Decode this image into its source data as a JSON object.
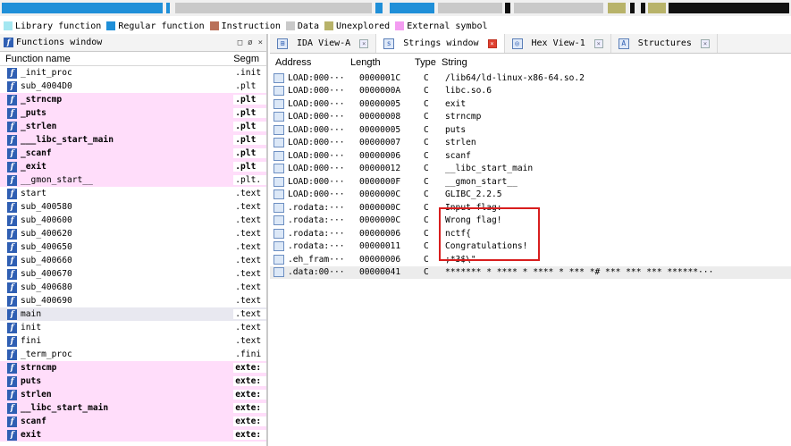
{
  "nav_band": {
    "colors": {
      "library": "#a4e7f1",
      "regular": "#1f8fd8",
      "instruction": "#b9715a",
      "data": "#c9c9c9",
      "unexplored": "#b8b36a",
      "external": "#f39cf1",
      "dark": "#111111"
    }
  },
  "legend": [
    {
      "label": "Library function",
      "color": "#a4e7f1"
    },
    {
      "label": "Regular function",
      "color": "#1f8fd8"
    },
    {
      "label": "Instruction",
      "color": "#b9715a"
    },
    {
      "label": "Data",
      "color": "#c9c9c9"
    },
    {
      "label": "Unexplored",
      "color": "#b8b36a"
    },
    {
      "label": "External symbol",
      "color": "#f39cf1"
    }
  ],
  "functions_window": {
    "title": "Functions window",
    "controls": {
      "restore": "□",
      "float": "ø",
      "close": "×"
    },
    "col_name": "Function name",
    "col_segment": "Segm",
    "rows": [
      {
        "name": "_init_proc",
        "segment": ".init",
        "style": "normal"
      },
      {
        "name": "sub_4004D0",
        "segment": ".plt",
        "style": "normal"
      },
      {
        "name": "_strncmp",
        "segment": ".plt",
        "style": "pink-bold"
      },
      {
        "name": "_puts",
        "segment": ".plt",
        "style": "pink-bold"
      },
      {
        "name": "_strlen",
        "segment": ".plt",
        "style": "pink-bold"
      },
      {
        "name": "___libc_start_main",
        "segment": ".plt",
        "style": "pink-bold"
      },
      {
        "name": "_scanf",
        "segment": ".plt",
        "style": "pink-bold"
      },
      {
        "name": "_exit",
        "segment": ".plt",
        "style": "pink-bold"
      },
      {
        "name": "__gmon_start__",
        "segment": ".plt.",
        "style": "pink"
      },
      {
        "name": "start",
        "segment": ".text",
        "style": "normal"
      },
      {
        "name": "sub_400580",
        "segment": ".text",
        "style": "normal"
      },
      {
        "name": "sub_400600",
        "segment": ".text",
        "style": "normal"
      },
      {
        "name": "sub_400620",
        "segment": ".text",
        "style": "normal"
      },
      {
        "name": "sub_400650",
        "segment": ".text",
        "style": "normal"
      },
      {
        "name": "sub_400660",
        "segment": ".text",
        "style": "normal"
      },
      {
        "name": "sub_400670",
        "segment": ".text",
        "style": "normal"
      },
      {
        "name": "sub_400680",
        "segment": ".text",
        "style": "normal"
      },
      {
        "name": "sub_400690",
        "segment": ".text",
        "style": "normal"
      },
      {
        "name": "main",
        "segment": ".text",
        "style": "selected"
      },
      {
        "name": "init",
        "segment": ".text",
        "style": "normal"
      },
      {
        "name": "fini",
        "segment": ".text",
        "style": "normal"
      },
      {
        "name": "_term_proc",
        "segment": ".fini",
        "style": "normal"
      },
      {
        "name": "strncmp",
        "segment": "exte:",
        "style": "pink-bold"
      },
      {
        "name": "puts",
        "segment": "exte:",
        "style": "pink-bold"
      },
      {
        "name": "strlen",
        "segment": "exte:",
        "style": "pink-bold"
      },
      {
        "name": "__libc_start_main",
        "segment": "exte:",
        "style": "pink-bold"
      },
      {
        "name": "scanf",
        "segment": "exte:",
        "style": "pink-bold"
      },
      {
        "name": "exit",
        "segment": "exte:",
        "style": "pink-bold"
      }
    ]
  },
  "tabs": [
    {
      "label": "IDA View-A",
      "active": false
    },
    {
      "label": "Strings window",
      "active": true
    },
    {
      "label": "Hex View-1",
      "active": false
    },
    {
      "label": "Structures",
      "active": false
    }
  ],
  "strings_window": {
    "col_address": "Address",
    "col_length": "Length",
    "col_type": "Type",
    "col_string": "String",
    "rows": [
      {
        "address": "LOAD:000···",
        "length": "0000001C",
        "type": "C",
        "string": "/lib64/ld-linux-x86-64.so.2"
      },
      {
        "address": "LOAD:000···",
        "length": "0000000A",
        "type": "C",
        "string": "libc.so.6"
      },
      {
        "address": "LOAD:000···",
        "length": "00000005",
        "type": "C",
        "string": "exit"
      },
      {
        "address": "LOAD:000···",
        "length": "00000008",
        "type": "C",
        "string": "strncmp"
      },
      {
        "address": "LOAD:000···",
        "length": "00000005",
        "type": "C",
        "string": "puts"
      },
      {
        "address": "LOAD:000···",
        "length": "00000007",
        "type": "C",
        "string": "strlen"
      },
      {
        "address": "LOAD:000···",
        "length": "00000006",
        "type": "C",
        "string": "scanf"
      },
      {
        "address": "LOAD:000···",
        "length": "00000012",
        "type": "C",
        "string": "__libc_start_main"
      },
      {
        "address": "LOAD:000···",
        "length": "0000000F",
        "type": "C",
        "string": "__gmon_start__"
      },
      {
        "address": "LOAD:000···",
        "length": "0000000C",
        "type": "C",
        "string": "GLIBC_2.2.5"
      },
      {
        "address": ".rodata:···",
        "length": "0000000C",
        "type": "C",
        "string": "Input flag:"
      },
      {
        "address": ".rodata:···",
        "length": "0000000C",
        "type": "C",
        "string": "Wrong flag!"
      },
      {
        "address": ".rodata:···",
        "length": "00000006",
        "type": "C",
        "string": "nctf{"
      },
      {
        "address": ".rodata:···",
        "length": "00000011",
        "type": "C",
        "string": "Congratulations!"
      },
      {
        "address": ".eh_fram···",
        "length": "00000006",
        "type": "C",
        "string": ";*3$\\\""
      },
      {
        "address": ".data:00···",
        "length": "00000041",
        "type": "C",
        "string": "  *******   *  **** * ****  * ***  *#  *** *** ***     ******···"
      }
    ]
  }
}
